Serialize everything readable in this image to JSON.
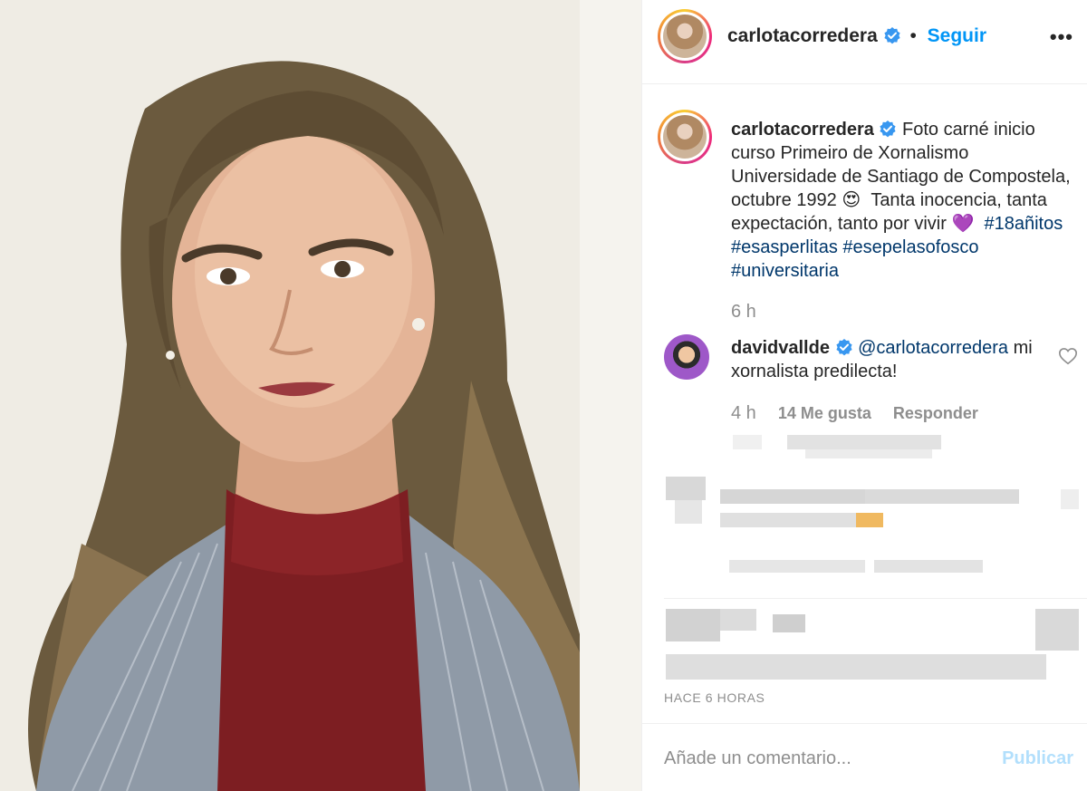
{
  "post": {
    "author": "carlotacorredera",
    "follow_label": "Seguir",
    "separator": "•",
    "more_label": "•••"
  },
  "caption": {
    "author": "carlotacorredera",
    "text_1": "Foto carné inicio curso Primeiro de Xornalismo Universidade de Santiago de Compostela, octubre 1992",
    "emoji_1": "😍",
    "text_2": "Tanta inocencia, tanta expectación, tanto por vivir",
    "emoji_2": "💜",
    "hashtags": [
      "#18añitos",
      "#esasperlitas",
      "#esepelasofosco",
      "#universitaria"
    ],
    "time": "6 h"
  },
  "comment": {
    "author": "davidvallde",
    "mention": "@carlotacorredera",
    "text": "mi xornalista predilecta!",
    "time": "4 h",
    "likes": "14 Me gusta",
    "reply_label": "Responder"
  },
  "footer": {
    "timestamp": "HACE 6 HORAS",
    "comment_placeholder": "Añade un comentario...",
    "publish_label": "Publicar"
  },
  "colors": {
    "accent": "#0095f6",
    "hashtag": "#00376b",
    "muted": "#8e8e8e",
    "verified": "#3897f0",
    "publish_disabled": "#b2dffc"
  }
}
